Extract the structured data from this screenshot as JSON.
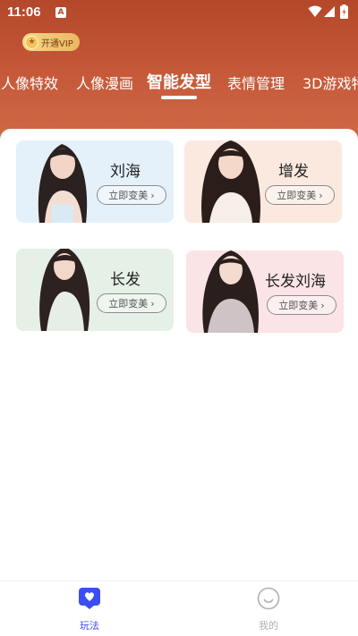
{
  "status_bar": {
    "time": "11:06",
    "notification_letter": "A"
  },
  "vip": {
    "label": "开通VIP"
  },
  "tabs": [
    {
      "label": "人像特效",
      "active": false
    },
    {
      "label": "人像漫画",
      "active": false
    },
    {
      "label": "智能发型",
      "active": true
    },
    {
      "label": "表情管理",
      "active": false
    },
    {
      "label": "3D游戏特",
      "active": false
    }
  ],
  "cards": [
    {
      "title": "刘海",
      "button": "立即变美",
      "bg": "#e4f1fb"
    },
    {
      "title": "增发",
      "button": "立即变美",
      "bg": "#fbe9df"
    },
    {
      "title": "长发",
      "button": "立即变美",
      "bg": "#e5f0e6"
    },
    {
      "title": "长发刘海",
      "button": "立即变美",
      "bg": "#fbe4e6"
    }
  ],
  "bottom_nav": [
    {
      "label": "玩法",
      "icon": "heart-chat-icon",
      "active": true,
      "color": "#3c4ef0"
    },
    {
      "label": "我的",
      "icon": "smile-face-icon",
      "active": false,
      "color": "#b0b0b0"
    }
  ],
  "colors": {
    "header_top": "#b5472a",
    "header_bottom": "#d06a48",
    "accent": "#3c4ef0"
  }
}
